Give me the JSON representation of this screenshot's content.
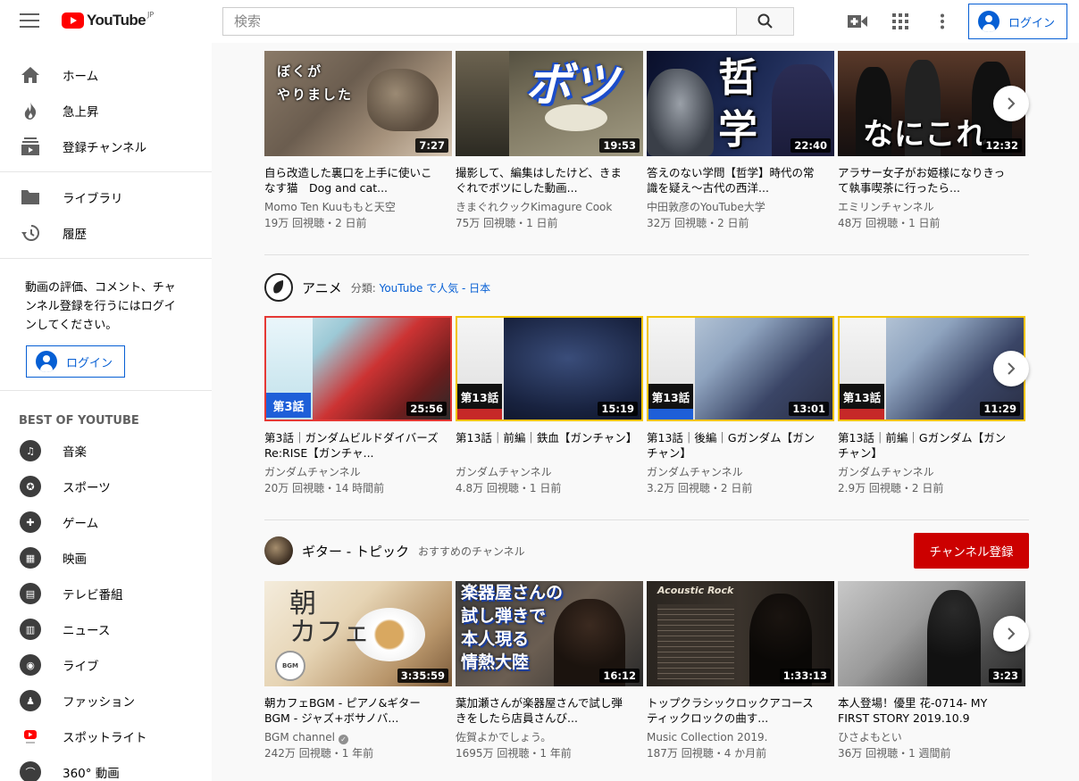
{
  "header": {
    "logo_text": "YouTube",
    "logo_region": "JP",
    "search_placeholder": "検索",
    "login_label": "ログイン"
  },
  "sidebar": {
    "main_items": [
      {
        "label": "ホーム",
        "icon": "home-icon"
      },
      {
        "label": "急上昇",
        "icon": "trending-icon"
      },
      {
        "label": "登録チャンネル",
        "icon": "subscriptions-icon"
      }
    ],
    "library_items": [
      {
        "label": "ライブラリ",
        "icon": "library-icon"
      },
      {
        "label": "履歴",
        "icon": "history-icon"
      }
    ],
    "promo_text": "動画の評価、コメント、チャンネル登録を行うにはログインしてください。",
    "login_label": "ログイン",
    "best_heading": "BEST OF YOUTUBE",
    "best_items": [
      {
        "label": "音楽",
        "icon": "music-icon"
      },
      {
        "label": "スポーツ",
        "icon": "sports-icon"
      },
      {
        "label": "ゲーム",
        "icon": "gaming-icon"
      },
      {
        "label": "映画",
        "icon": "movies-icon"
      },
      {
        "label": "テレビ番組",
        "icon": "tv-icon"
      },
      {
        "label": "ニュース",
        "icon": "news-icon"
      },
      {
        "label": "ライブ",
        "icon": "live-icon"
      },
      {
        "label": "ファッション",
        "icon": "fashion-icon"
      },
      {
        "label": "スポットライト",
        "icon": "spotlight-icon"
      },
      {
        "label": "360° 動画",
        "icon": "360-video-icon"
      }
    ]
  },
  "shelves": [
    {
      "videos": [
        {
          "thumb_text": "ぼくが\nやりました",
          "duration": "7:27",
          "title": "自ら改造した裏口を上手に使いこなす猫　Dog and cat...",
          "channel": "Momo Ten Kuuももと天空",
          "meta": "19万 回視聴・2 日前"
        },
        {
          "thumb_text": "ボツ",
          "duration": "19:53",
          "title": "撮影して、編集はしたけど、きまぐれでボツにした動画...",
          "channel": "きまぐれクックKimagure Cook",
          "meta": "75万 回視聴・1 日前"
        },
        {
          "thumb_text": "哲\n学",
          "duration": "22:40",
          "title": "答えのない学問【哲学】時代の常識を疑え～古代の西洋...",
          "channel": "中田敦彦のYouTube大学",
          "meta": "32万 回視聴・2 日前"
        },
        {
          "thumb_text": "なにこれ",
          "duration": "12:32",
          "title": "アラサー女子がお姫様になりきって執事喫茶に行ったら...",
          "channel": "エミリンチャンネル",
          "meta": "48万 回視聴・1 日前"
        }
      ]
    },
    {
      "title": "アニメ",
      "sub_prefix": "分類:",
      "sub_link": "YouTube で人気 - 日本",
      "videos": [
        {
          "thumb_text": "第3話",
          "duration": "25:56",
          "title": "第3話｜ガンダムビルドダイバーズRe:RISE【ガンチャ...",
          "channel": "ガンダムチャンネル",
          "meta": "20万 回視聴・14 時間前"
        },
        {
          "thumb_text": "第13話",
          "duration": "15:19",
          "title": "第13話｜前編｜鉄血【ガンチャン】",
          "channel": "ガンダムチャンネル",
          "meta": "4.8万 回視聴・1 日前"
        },
        {
          "thumb_text": "第13話",
          "duration": "13:01",
          "title": "第13話｜後編｜Gガンダム【ガンチャン】",
          "channel": "ガンダムチャンネル",
          "meta": "3.2万 回視聴・2 日前"
        },
        {
          "thumb_text": "第13話",
          "duration": "11:29",
          "title": "第13話｜前編｜Gガンダム【ガンチャン】",
          "channel": "ガンダムチャンネル",
          "meta": "2.9万 回視聴・2 日前"
        }
      ]
    },
    {
      "title": "ギター - トピック",
      "sub_prefix": "おすすめのチャンネル",
      "subscribe_label": "チャンネル登録",
      "videos": [
        {
          "thumb_text": "朝\nカフェ",
          "duration": "3:35:59",
          "title": "朝カフェBGM - ピアノ&ギターBGM - ジャズ+ボサノバ...",
          "channel": "BGM channel",
          "verified": true,
          "meta": "242万 回視聴・1 年前"
        },
        {
          "thumb_text": "楽器屋さんの\n試し弾きで\n本人現る\n情熱大陸",
          "duration": "16:12",
          "title": "葉加瀬さんが楽器屋さんで試し弾きをしたら店員さんび...",
          "channel": "佐賀よかでしょう。",
          "meta": "1695万 回視聴・1 年前"
        },
        {
          "thumb_text": "Acoustic Rock",
          "duration": "1:33:13",
          "title": "トップクラシックロックアコースティックロックの曲す...",
          "channel": "Music Collection 2019.",
          "meta": "187万 回視聴・4 か月前"
        },
        {
          "thumb_text": "",
          "duration": "3:23",
          "title": "本人登場！優里 花-0714- MY FIRST STORY 2019.10.9",
          "channel": "ひさよもとい",
          "meta": "36万 回視聴・1 週間前"
        }
      ]
    }
  ],
  "colors": {
    "accent": "#065fd4",
    "brand_red": "#ff0000",
    "subscribe_red": "#cc0000"
  }
}
